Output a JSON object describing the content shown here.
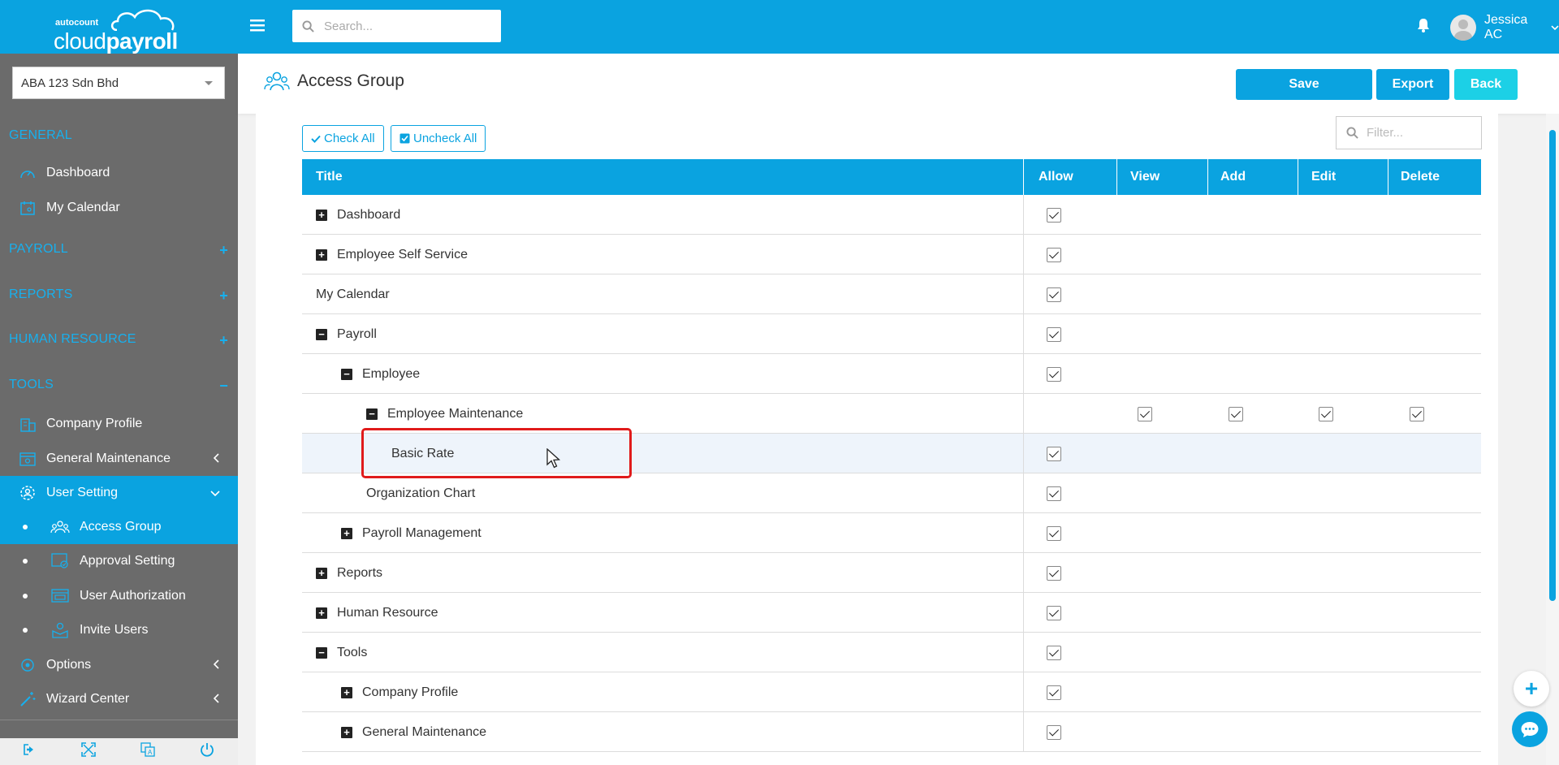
{
  "topbar": {
    "logo_small": "autocount",
    "logo_big_1": "cloud",
    "logo_big_2": "payroll",
    "search_placeholder": "Search...",
    "user_name": "Jessica AC"
  },
  "sidebar": {
    "company": "ABA 123 Sdn Bhd",
    "sections": {
      "general": "GENERAL",
      "payroll": "PAYROLL",
      "reports": "REPORTS",
      "human_resource": "HUMAN RESOURCE",
      "tools": "TOOLS"
    },
    "items": {
      "dashboard": "Dashboard",
      "my_calendar": "My Calendar",
      "company_profile": "Company Profile",
      "general_maintenance": "General Maintenance",
      "user_setting": "User Setting",
      "access_group": "Access Group",
      "approval_setting": "Approval Setting",
      "user_authorization": "User Authorization",
      "invite_users": "Invite Users",
      "options": "Options",
      "wizard_center": "Wizard Center"
    }
  },
  "header": {
    "title": "Access Group",
    "save": "Save",
    "export": "Export",
    "back": "Back"
  },
  "toolbar": {
    "check_all": "Check All",
    "uncheck_all": "Uncheck All",
    "filter_placeholder": "Filter..."
  },
  "table": {
    "columns": {
      "title": "Title",
      "allow": "Allow",
      "view": "View",
      "add": "Add",
      "edit": "Edit",
      "delete": "Delete"
    },
    "rows": [
      {
        "label": "Dashboard",
        "level": 0,
        "toggle": "plus",
        "allow": true
      },
      {
        "label": "Employee Self Service",
        "level": 0,
        "toggle": "plus",
        "allow": true
      },
      {
        "label": "My Calendar",
        "level": 0,
        "toggle": "none",
        "allow": true
      },
      {
        "label": "Payroll",
        "level": 0,
        "toggle": "minus",
        "allow": true
      },
      {
        "label": "Employee",
        "level": 1,
        "toggle": "minus",
        "allow": true
      },
      {
        "label": "Employee Maintenance",
        "level": 2,
        "toggle": "minus",
        "allow": false,
        "view": true,
        "add": true,
        "edit": true,
        "delete": true
      },
      {
        "label": "Basic Rate",
        "level": 3,
        "toggle": "none",
        "allow": true
      },
      {
        "label": "Organization Chart",
        "level": 2,
        "toggle": "none",
        "allow": true
      },
      {
        "label": "Payroll Management",
        "level": 1,
        "toggle": "plus",
        "allow": true
      },
      {
        "label": "Reports",
        "level": 0,
        "toggle": "plus",
        "allow": true
      },
      {
        "label": "Human Resource",
        "level": 0,
        "toggle": "plus",
        "allow": true
      },
      {
        "label": "Tools",
        "level": 0,
        "toggle": "minus",
        "allow": true
      },
      {
        "label": "Company Profile",
        "level": 1,
        "toggle": "plus",
        "allow": true
      },
      {
        "label": "General Maintenance",
        "level": 1,
        "toggle": "plus",
        "allow": true
      }
    ]
  },
  "colors": {
    "primary": "#0aa3e0",
    "back_button": "#1cd0e6",
    "sidebar_bg": "#6b6b6b",
    "highlight_border": "#e01b1b"
  }
}
